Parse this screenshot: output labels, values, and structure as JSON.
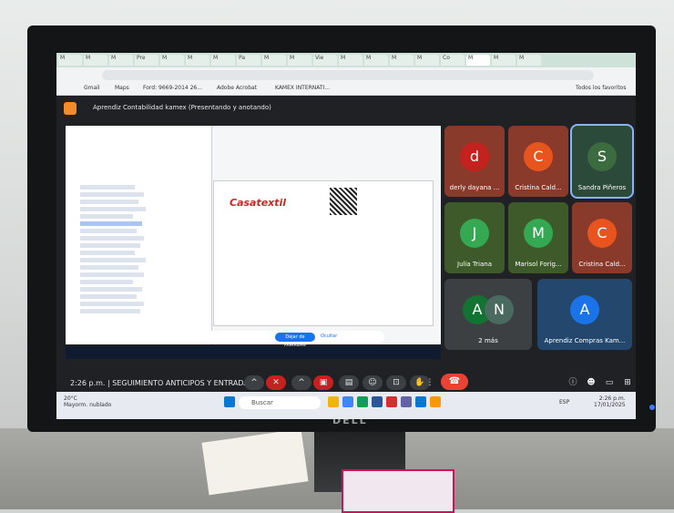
{
  "browser": {
    "tabs": [
      "M",
      "M",
      "M",
      "Pre",
      "M",
      "M",
      "M",
      "Pa",
      "M",
      "M",
      "Vie",
      "M",
      "M",
      "M",
      "M",
      "Co",
      "M",
      "M",
      "M"
    ],
    "url": "",
    "bookmarks": [
      "Gmail",
      "Maps",
      "Ford: 9669-2014 26...",
      "Adobe Acrobat",
      "KAMEX INTERNATI..."
    ],
    "all_bookmarks": "Todos los favoritos"
  },
  "meet": {
    "title": "Aprendiz Contabilidad kamex (Presentando y anotando)",
    "presentation": {
      "company": "Casatextil",
      "stop_sharing": "Dejar de compartir",
      "ocultar": "Ocultar"
    },
    "participants": [
      {
        "initial": "d",
        "name": "derly dayana ...",
        "color": "#c5221f"
      },
      {
        "initial": "C",
        "name": "Cristina Cald...",
        "color": "#e8541e"
      },
      {
        "initial": "S",
        "name": "Sandra Piñeros",
        "color": "#3b6b3f"
      },
      {
        "initial": "J",
        "name": "Julia Triana",
        "color": "#34a853"
      },
      {
        "initial": "M",
        "name": "Marisol Forig...",
        "color": "#34a853"
      },
      {
        "initial": "C",
        "name": "Cristina Cald...",
        "color": "#e8541e"
      },
      {
        "initial": "A",
        "name": "2 más",
        "color": "#137333"
      },
      {
        "initial": "A",
        "name": "Aprendiz Compras Kam...",
        "color": "#1a73e8"
      }
    ],
    "more_initial": "N",
    "time": "2:26 p.m.",
    "meeting_name": "SEGUIMIENTO ANTICIPOS Y ENTRADA..."
  },
  "taskbar": {
    "search_placeholder": "Buscar",
    "weather_temp": "20°C",
    "weather_desc": "Mayorm. nublado",
    "clock_time": "2:26 p.m.",
    "clock_date": "17/01/2025",
    "lang": "ESP"
  },
  "monitor_brand": "DELL"
}
